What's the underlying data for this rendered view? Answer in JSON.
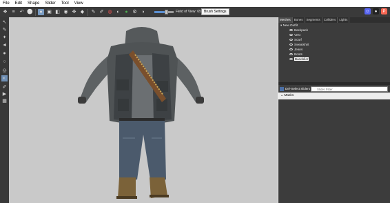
{
  "menu": [
    "File",
    "Edit",
    "Shape",
    "Slider",
    "Tool",
    "View"
  ],
  "toolbar": {
    "fov_label": "Field of View: 65",
    "fov_fraction": 0.6,
    "brush_settings_label": "Brush Settings"
  },
  "panel": {
    "tabs": [
      "Meshes",
      "Bones",
      "Segments",
      "Colliders",
      "Lights"
    ],
    "tree_root": "New Outfit",
    "meshes": [
      "Backpack",
      "Vest",
      "Scarf",
      "Sweatshirt",
      "Jeans",
      "Boots",
      "Bandolier"
    ],
    "deselect_label": "De/-Select Sliders",
    "filter_placeholder": "Slider Filter",
    "masks_label": "Masks"
  },
  "colors": {
    "toolbar_bg": "#3a3a3a",
    "viewport_bg": "#c9c9c9",
    "accent": "#5b8fd1"
  }
}
